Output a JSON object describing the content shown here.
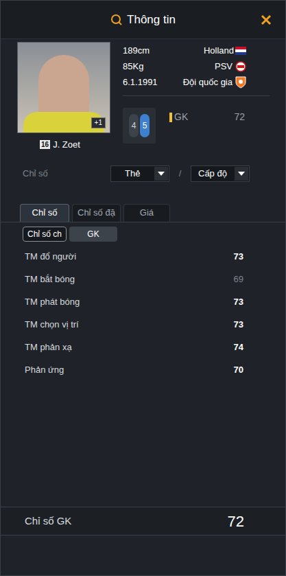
{
  "window": {
    "title": "Thông tin"
  },
  "player": {
    "number": "16",
    "name": "J. Zoet",
    "photo_badge": "+1",
    "height": "189cm",
    "weight": "85Kg",
    "birthdate": "6.1.1991",
    "nation": "Holland",
    "club": "PSV",
    "national_team": "Đội quốc gia"
  },
  "feet": [
    {
      "value": "4",
      "strong": false
    },
    {
      "value": "5",
      "strong": true
    }
  ],
  "position": {
    "label": "GK",
    "rating": "72"
  },
  "filters": {
    "label": "Chỉ số",
    "separator": "/",
    "dropdowns": [
      "Thẻ",
      "Cấp độ"
    ]
  },
  "tabs": [
    {
      "label": "Chỉ số",
      "selected": true
    },
    {
      "label": "Chỉ số đặ",
      "selected": false
    },
    {
      "label": "Giá",
      "selected": false
    }
  ],
  "subtabs": [
    {
      "label": "Chỉ số ch",
      "selected": false
    },
    {
      "label": "GK",
      "selected": true
    }
  ],
  "stats": [
    {
      "label": "TM đổ người",
      "value": "73",
      "dimmed": false
    },
    {
      "label": "TM bắt bóng",
      "value": "69",
      "dimmed": true
    },
    {
      "label": "TM phát bóng",
      "value": "73",
      "dimmed": false
    },
    {
      "label": "TM chọn vị trí",
      "value": "73",
      "dimmed": false
    },
    {
      "label": "TM phản xạ",
      "value": "74",
      "dimmed": false
    },
    {
      "label": "Phản ứng",
      "value": "70",
      "dimmed": false
    }
  ],
  "summary": {
    "label": "Chỉ số GK",
    "value": "72"
  }
}
